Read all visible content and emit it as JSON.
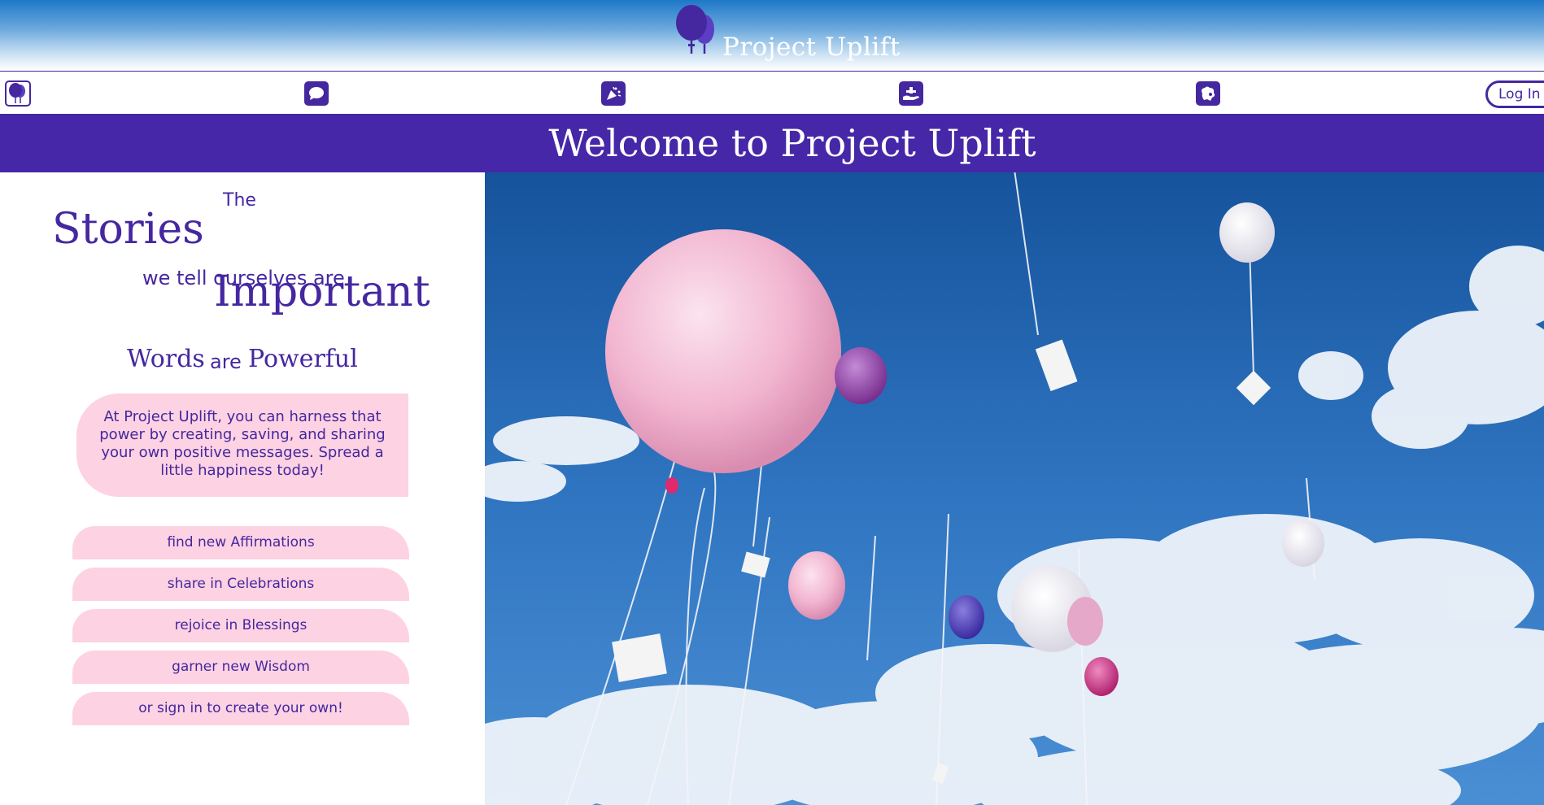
{
  "header": {
    "title": "Project Uplift",
    "logo_icon": "balloons-logo-icon",
    "gradient_top": "#1e78c8"
  },
  "nav": {
    "items": [
      {
        "icon": "balloon-home-icon"
      },
      {
        "icon": "speech-bubble-icon"
      },
      {
        "icon": "party-popper-icon"
      },
      {
        "icon": "giving-hand-icon"
      },
      {
        "icon": "brain-icon"
      }
    ],
    "login_label": "Log In"
  },
  "banner": {
    "title": "Welcome to Project Uplift",
    "color": "#4527a7"
  },
  "hero": {
    "the": "The",
    "stories": "Stories",
    "we_tell": "we tell ourselves are",
    "important": "Important",
    "words": "Words",
    "are": "are",
    "powerful": "Powerful",
    "intro": "At Project Uplift, you can harness that power by creating, saving, and sharing your own positive messages. Spread a little happiness today!"
  },
  "links": [
    {
      "label": "find new Affirmations"
    },
    {
      "label": "share in Celebrations"
    },
    {
      "label": "rejoice in Blessings"
    },
    {
      "label": "garner new Wisdom"
    },
    {
      "label": "or sign in to create your own!"
    }
  ],
  "colors": {
    "accent": "#4527a0",
    "pill": "#fdd2e2",
    "sky": "#2f6fb8"
  },
  "photo": {
    "icon": "balloons-in-sky-photo"
  }
}
